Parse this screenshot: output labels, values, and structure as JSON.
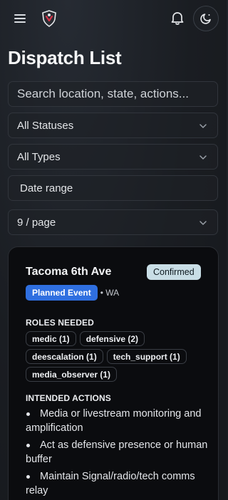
{
  "header": {
    "menu_icon": "hamburger-icon",
    "logo_icon": "shield-logo-icon",
    "notifications_icon": "bell-icon",
    "theme_icon": "theme-toggle-icon"
  },
  "page": {
    "title": "Dispatch List"
  },
  "filters": {
    "search_placeholder": "Search location, state, actions...",
    "status_value": "All Statuses",
    "type_value": "All Types",
    "date_placeholder": "Date range",
    "page_size_value": "9 / page"
  },
  "card": {
    "title": "Tacoma 6th Ave",
    "status": "Confirmed",
    "event_type": "Planned Event",
    "state": "• WA",
    "roles_label": "ROLES NEEDED",
    "roles": [
      "medic (1)",
      "defensive (2)",
      "deescalation (1)",
      "tech_support (1)",
      "media_observer (1)"
    ],
    "actions_label": "INTENDED ACTIONS",
    "actions": [
      "Media or livestream monitoring and amplification",
      "Act as defensive presence or human buffer",
      "Maintain Signal/radio/tech comms relay"
    ]
  },
  "colors": {
    "background": "#1a1d22",
    "card_bg": "#0b0c0f",
    "confirmed_badge": "#c9dee6",
    "event_badge": "#2f6fe0"
  }
}
